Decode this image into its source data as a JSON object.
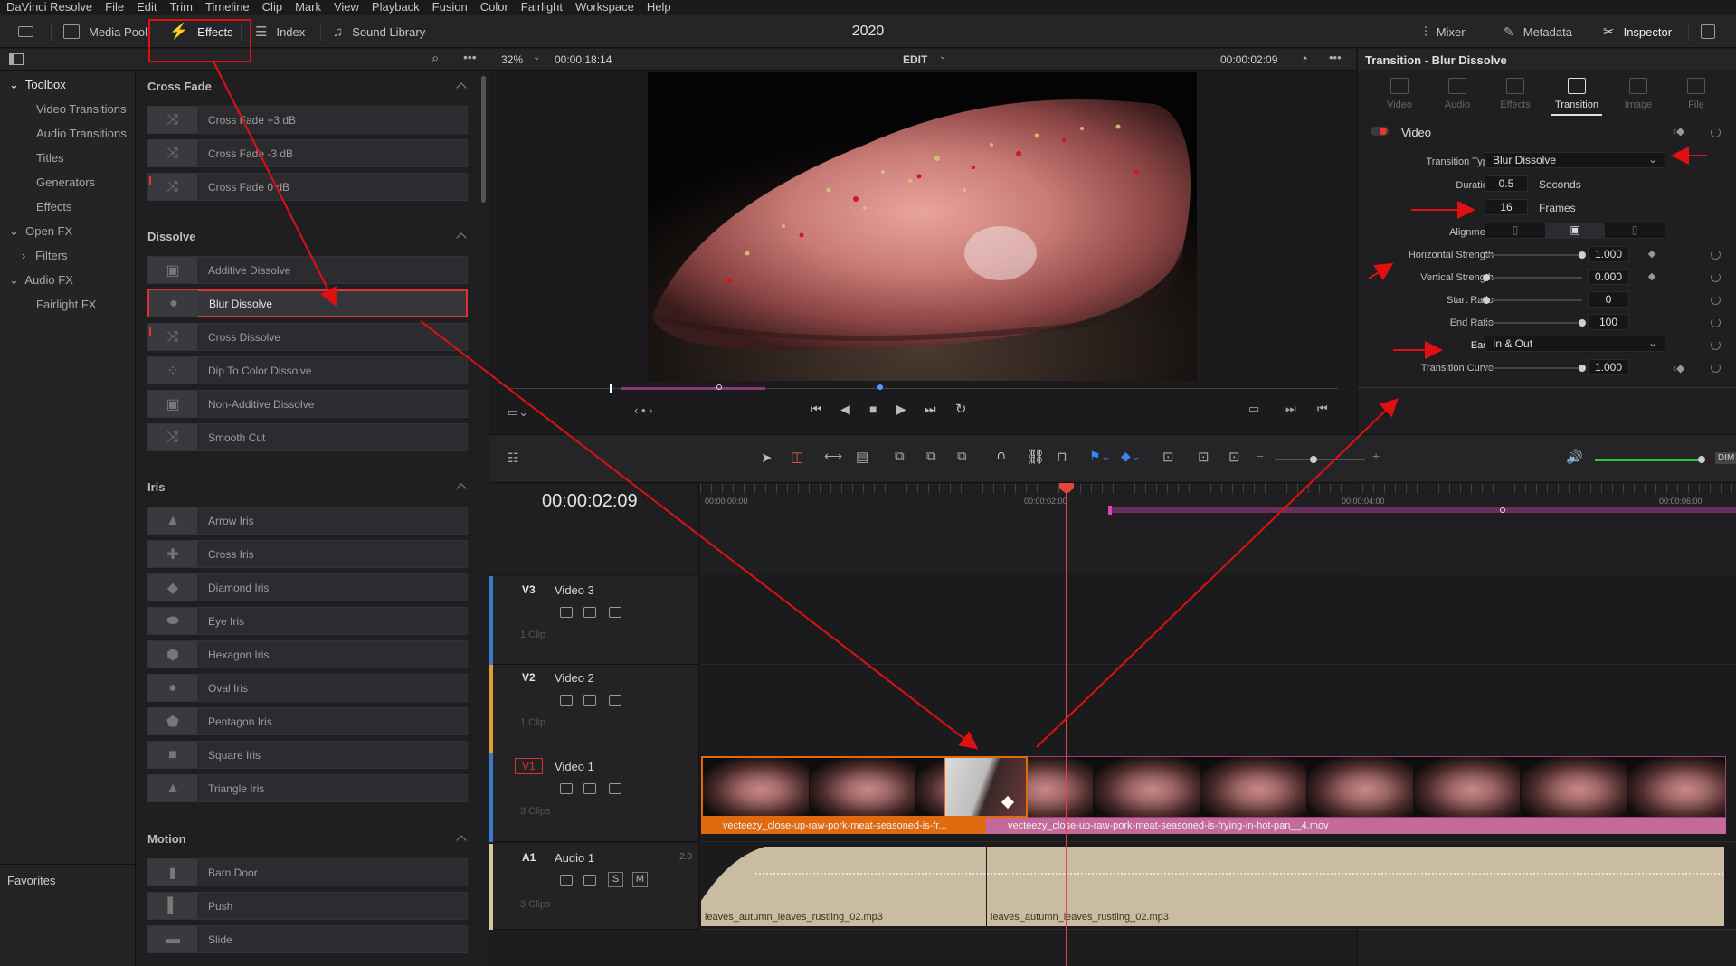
{
  "menu": [
    "DaVinci Resolve",
    "File",
    "Edit",
    "Trim",
    "Timeline",
    "Clip",
    "Mark",
    "View",
    "Playback",
    "Fusion",
    "Color",
    "Fairlight",
    "Workspace",
    "Help"
  ],
  "toolbar": {
    "media_pool": "Media Pool",
    "effects": "Effects",
    "index": "Index",
    "sound_library": "Sound Library",
    "project_title": "2020",
    "mixer": "Mixer",
    "metadata": "Metadata",
    "inspector": "Inspector"
  },
  "toolbox": {
    "items": [
      "Toolbox",
      "Video Transitions",
      "Audio Transitions",
      "Titles",
      "Generators",
      "Effects",
      "Open FX",
      "Filters",
      "Audio FX",
      "Fairlight FX"
    ],
    "favorites": "Favorites"
  },
  "effects_list": {
    "cross_fade": {
      "title": "Cross Fade",
      "items": [
        "Cross Fade +3 dB",
        "Cross Fade -3 dB",
        "Cross Fade 0 dB"
      ]
    },
    "dissolve": {
      "title": "Dissolve",
      "items": [
        "Additive Dissolve",
        "Blur Dissolve",
        "Cross Dissolve",
        "Dip To Color Dissolve",
        "Non-Additive Dissolve",
        "Smooth Cut"
      ]
    },
    "iris": {
      "title": "Iris",
      "items": [
        "Arrow Iris",
        "Cross Iris",
        "Diamond Iris",
        "Eye Iris",
        "Hexagon Iris",
        "Oval Iris",
        "Pentagon Iris",
        "Square Iris",
        "Triangle Iris"
      ]
    },
    "motion": {
      "title": "Motion",
      "items": [
        "Barn Door",
        "Push",
        "Slide"
      ]
    }
  },
  "viewer": {
    "zoom": "32%",
    "source_tc": "00:00:18:14",
    "mode": "EDIT",
    "timecode": "00:00:02:09"
  },
  "inspector": {
    "title": "Transition - Blur Dissolve",
    "tabs": [
      "Video",
      "Audio",
      "Effects",
      "Transition",
      "Image",
      "File"
    ],
    "section": "Video",
    "labels": {
      "transition_type": "Transition Type",
      "duration": "Duration",
      "alignment": "Alignment",
      "horizontal_strength": "Horizontal Strength",
      "vertical_strength": "Vertical Strength",
      "start_ratio": "Start Ratio",
      "end_ratio": "End Ratio",
      "ease": "Ease",
      "transition_curve": "Transition Curve"
    },
    "values": {
      "transition_type": "Blur Dissolve",
      "duration_seconds": "0.5",
      "seconds_unit": "Seconds",
      "duration_frames": "16",
      "frames_unit": "Frames",
      "horizontal_strength": "1.000",
      "vertical_strength": "0.000",
      "start_ratio": "0",
      "end_ratio": "100",
      "ease": "In & Out",
      "transition_curve": "1.000"
    }
  },
  "timeline": {
    "timecode": "00:00:02:09",
    "ruler": [
      "00:00:00:00",
      "00:00:02:00",
      "00:00:04:00",
      "00:00:06:00"
    ],
    "tracks": {
      "v3": {
        "id": "V3",
        "name": "Video 3",
        "clips": "1 Clip"
      },
      "v2": {
        "id": "V2",
        "name": "Video 2",
        "clips": "1 Clip"
      },
      "v1": {
        "id": "V1",
        "name": "Video 1",
        "clips": "3 Clips"
      },
      "a1": {
        "id": "A1",
        "name": "Audio 1",
        "level": "2.0",
        "clips": "3 Clips"
      }
    },
    "video_clips": [
      "vecteezy_close-up-raw-pork-meat-seasoned-is-fr...",
      "vecteezy_close-up-raw-pork-meat-seasoned-is-frying-in-hot-pan__4.mov"
    ],
    "audio_clips": [
      "leaves_autumn_leaves_rustling_02.mp3",
      "leaves_autumn_leaves_rustling_02.mp3"
    ],
    "audio_buttons": [
      "S",
      "M"
    ],
    "dim": "DIM"
  },
  "colors": {
    "accent_red": "#e4463b",
    "clip_orange": "#e06a10",
    "clip_pink": "#c36a9a",
    "audio_clip": "#c9bca1"
  }
}
